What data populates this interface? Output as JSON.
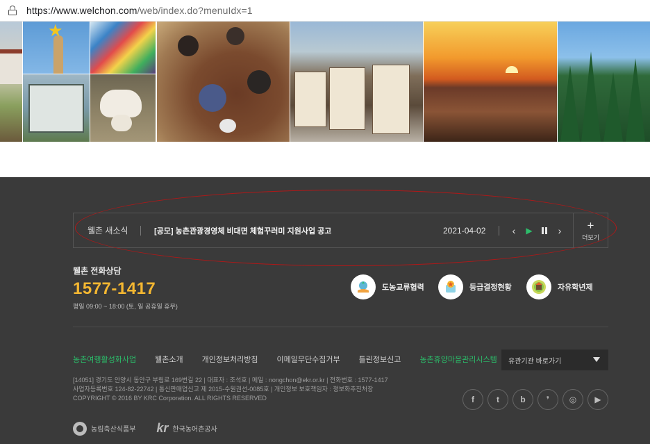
{
  "browser": {
    "url_host": "https://www.welchon.com",
    "url_path": "/web/index.do?menuIdx=1"
  },
  "news": {
    "title": "웰촌 새소식",
    "headline": "[공모] 농촌관광경영체 비대면 체험꾸러미 지원사업 공고",
    "date": "2021-04-02",
    "more_label": "더보기"
  },
  "contact": {
    "label": "웰촌 전화상담",
    "number": "1577-1417",
    "hours": "평일 09:00 ~ 18:00 (토, 일 공휴일 휴무)"
  },
  "quick_links": [
    {
      "label": "도농교류협력",
      "icon": "handshake-icon"
    },
    {
      "label": "등급결정현황",
      "icon": "rating-icon"
    },
    {
      "label": "자유학년제",
      "icon": "school-icon"
    }
  ],
  "footer_links": [
    {
      "label": "농촌여행활성화사업",
      "highlight": true
    },
    {
      "label": "웰촌소개",
      "highlight": false
    },
    {
      "label": "개인정보처리방침",
      "highlight": false
    },
    {
      "label": "이메일무단수집거부",
      "highlight": false
    },
    {
      "label": "틀린정보신고",
      "highlight": false
    },
    {
      "label": "농촌휴양마을관리시스템",
      "highlight": true
    }
  ],
  "related_select": {
    "label": "유관기관 바로가기"
  },
  "address": {
    "line1": "[14051] 경기도 안양시 동안구 부림로 169번길 22 | 대표자 : 조석호 | 메일 : nongchon@ekr.or.kr | 전화번호 : 1577-1417",
    "line2": "사업자등록번호 124-82-22742 | 통신판매업신고 제 2015-수원권선-0085호 | 개인정보 보호책임자 : 정보화추진처장",
    "line3": "COPYRIGHT © 2016 BY KRC Corporation. ALL RIGHTS RESERVED"
  },
  "sns": [
    {
      "name": "facebook-icon",
      "glyph": "f"
    },
    {
      "name": "twitter-icon",
      "glyph": "t"
    },
    {
      "name": "blog-icon",
      "glyph": "b"
    },
    {
      "name": "post-icon",
      "glyph": "❜"
    },
    {
      "name": "instagram-icon",
      "glyph": "◎"
    },
    {
      "name": "youtube-icon",
      "glyph": "▶"
    }
  ],
  "logos": {
    "ministry": "농림축산식품부",
    "krc_mark": "kr",
    "krc_name": "한국농어촌공사"
  },
  "colors": {
    "footer_bg": "#3a3a3a",
    "accent_green": "#2bbd6a",
    "phone_yellow": "#f4b731",
    "annotation_red": "#b01818"
  }
}
